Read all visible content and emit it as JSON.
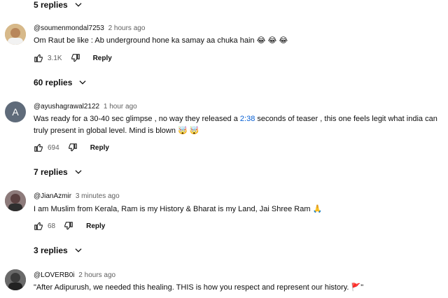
{
  "threads": [
    {
      "replies_label": "5 replies"
    },
    {
      "handle": "@soumenmondal7253",
      "time": "2 hours ago",
      "text": "Om Raut be like : Ab underground hone ka samay aa chuka hain",
      "emoji": "😂 😂 😂",
      "likes": "3.1K",
      "reply_label": "Reply",
      "replies_label": "60 replies",
      "avatar_color": "#c9a36b"
    },
    {
      "handle": "@ayushagrawal2122",
      "time": "1 hour ago",
      "text_before": "Was ready for a 30-40 sec glimpse , no way they released a ",
      "link": "2:38",
      "text_after": " seconds of teaser , this one feels legit what india can truly present in global level. Mind is blown",
      "emoji": "🤯 🤯",
      "likes": "694",
      "reply_label": "Reply",
      "replies_label": "7 replies",
      "avatar_letter": "A",
      "avatar_color": "#5f6b7a"
    },
    {
      "handle": "@JianAzmir",
      "time": "3 minutes ago",
      "text": "I am Muslim from Kerala, Ram is my History & Bharat is my Land, Jai Shree Ram",
      "emoji": "🙏",
      "likes": "68",
      "reply_label": "Reply",
      "replies_label": "3 replies",
      "avatar_color": "#6b5a5a"
    },
    {
      "handle": "@LOVERB0i",
      "time": "2 hours ago",
      "text": "\"After Adipurush, we needed this healing. THIS is how you respect and represent our history.",
      "emoji": "🚩",
      "text_end": "\"",
      "avatar_color": "#4a4a4a"
    }
  ],
  "colors": {
    "link": "#065fd4",
    "secondary_text": "#606060",
    "primary_text": "#0f0f0f"
  },
  "icons": [
    "chevron-down-icon",
    "thumbs-up-icon",
    "thumbs-down-icon"
  ]
}
